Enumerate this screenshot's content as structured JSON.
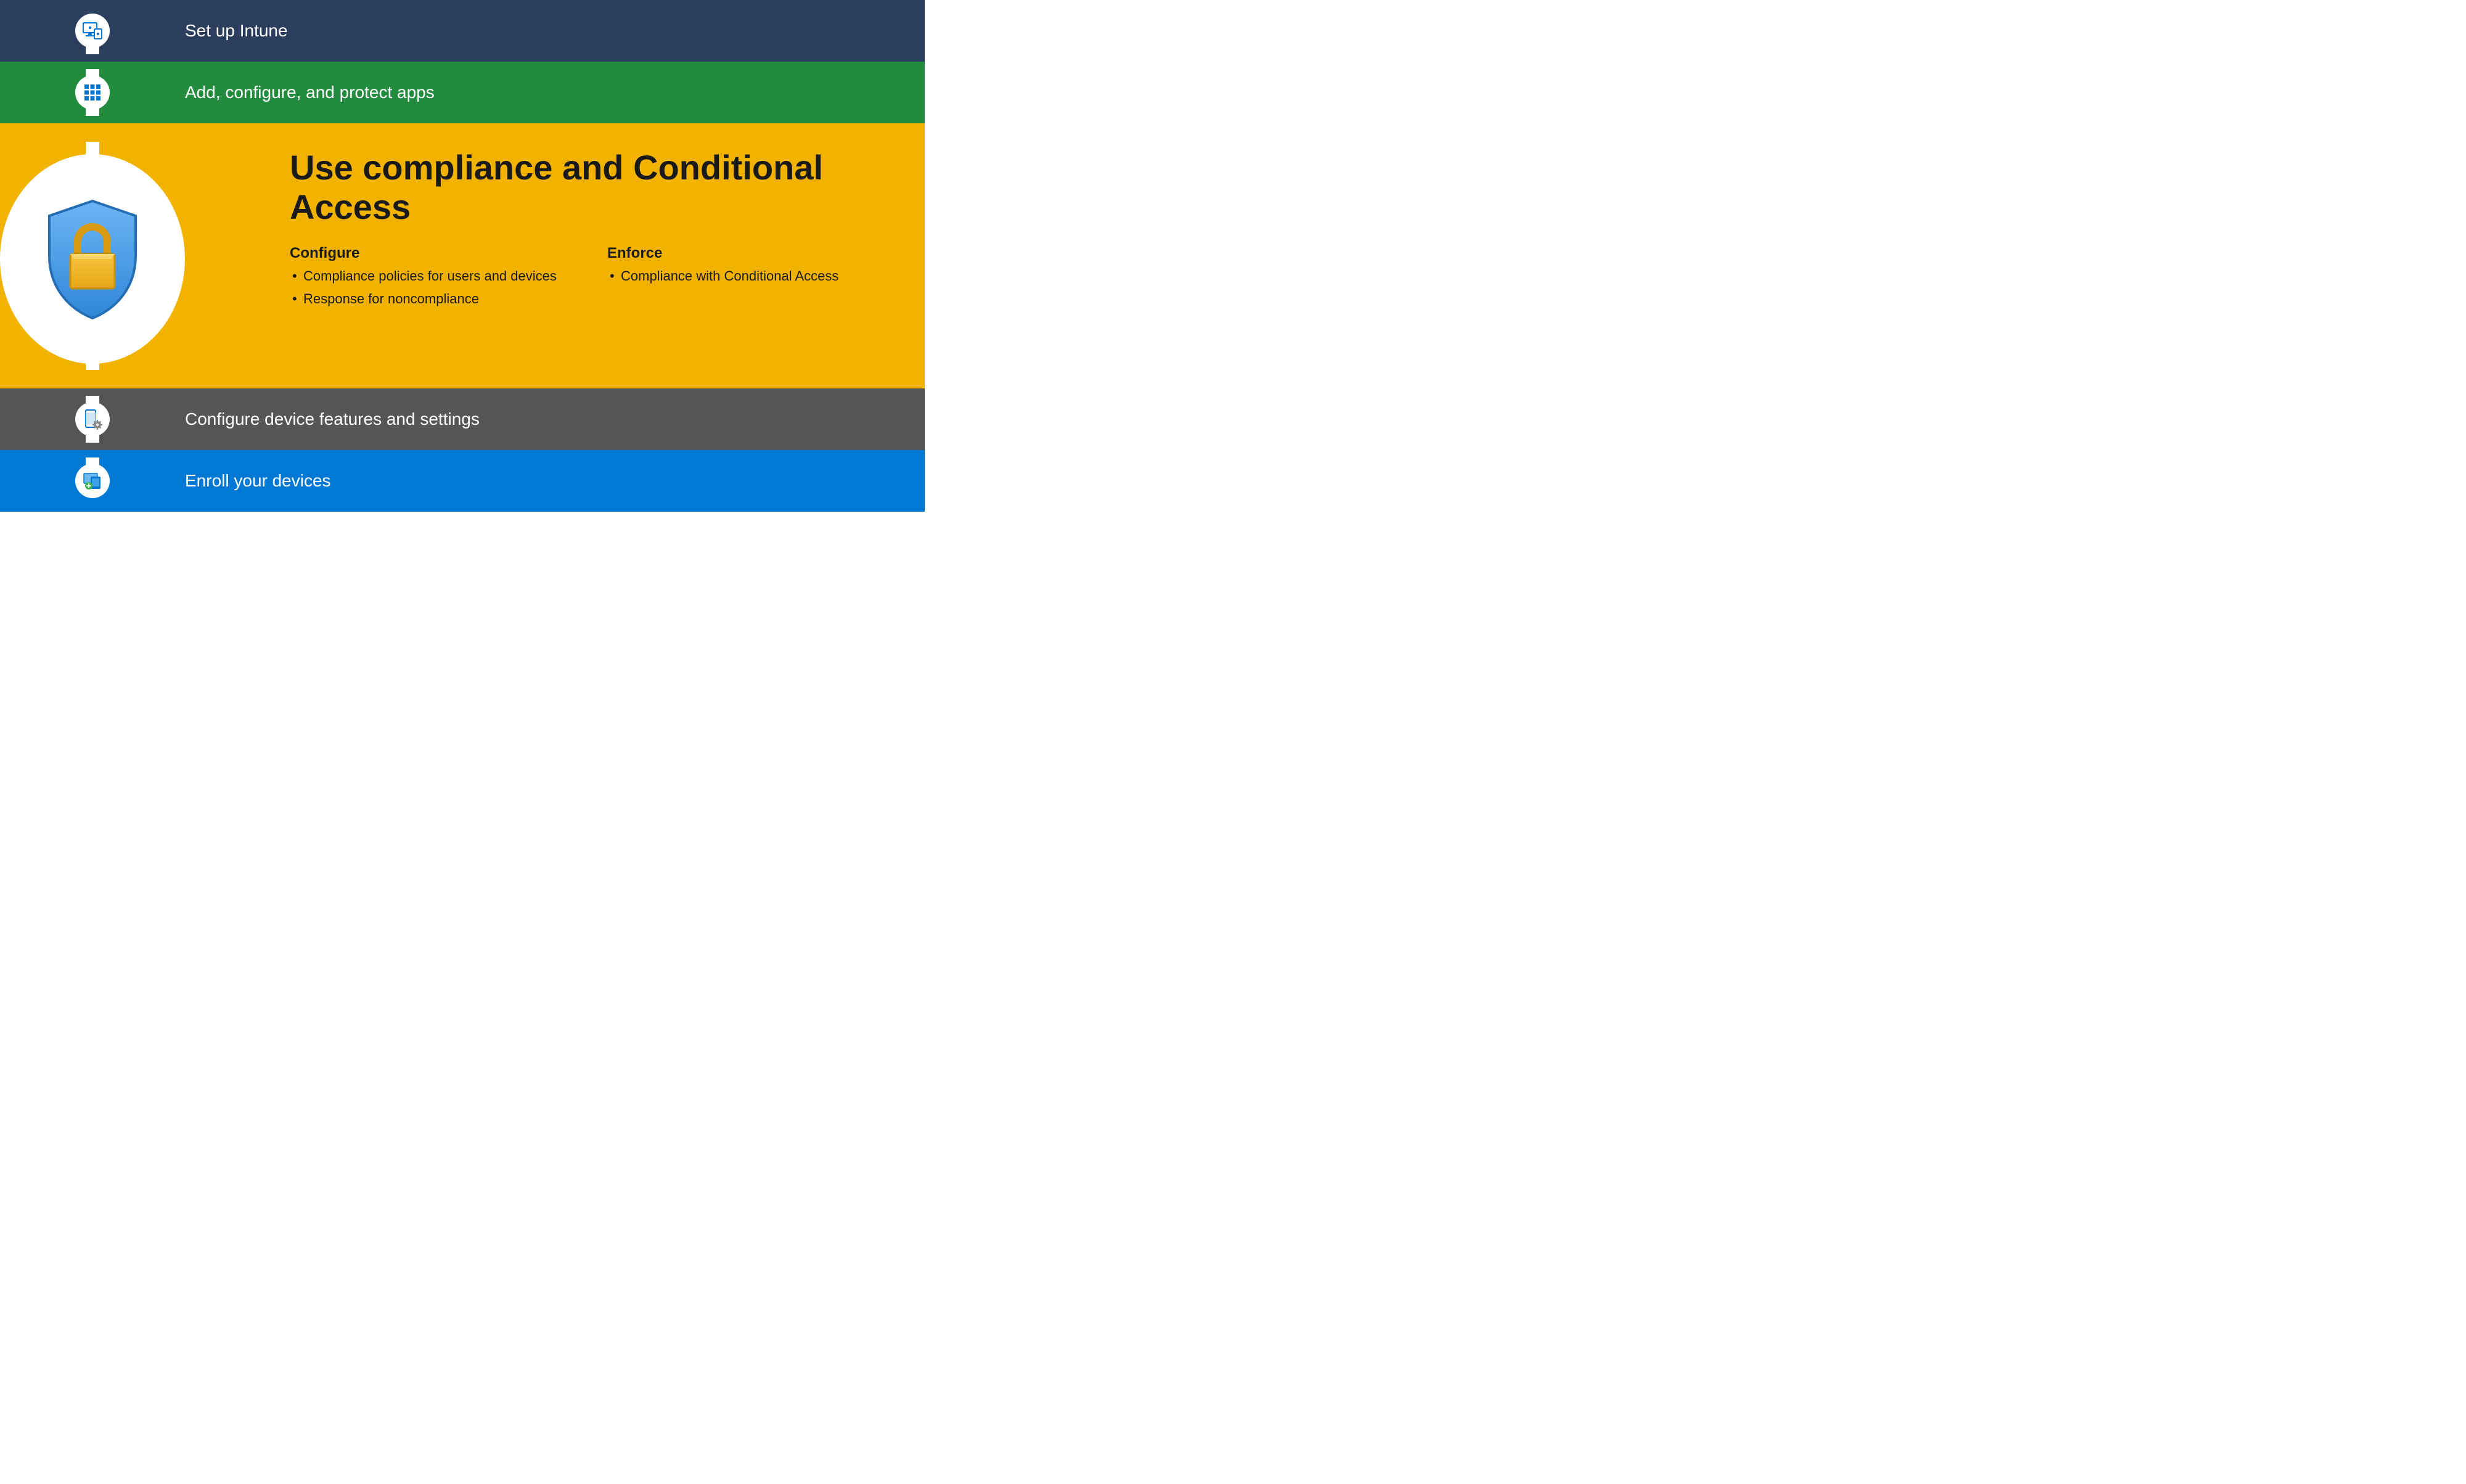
{
  "steps": {
    "setup": {
      "label": "Set up Intune",
      "color": "#2c3e5d"
    },
    "apps": {
      "label": "Add, configure, and protect apps",
      "color": "#228b3d"
    },
    "compliance": {
      "title": "Use compliance and Conditional Access",
      "color": "#f2b200",
      "configure": {
        "heading": "Configure",
        "items": [
          "Compliance policies for users and devices",
          "Response for noncompliance"
        ]
      },
      "enforce": {
        "heading": "Enforce",
        "items": [
          "Compliance with Conditional Access"
        ]
      }
    },
    "configure": {
      "label": "Configure device features and settings",
      "color": "#555555"
    },
    "enroll": {
      "label": "Enroll your devices",
      "color": "#0078d4"
    }
  }
}
